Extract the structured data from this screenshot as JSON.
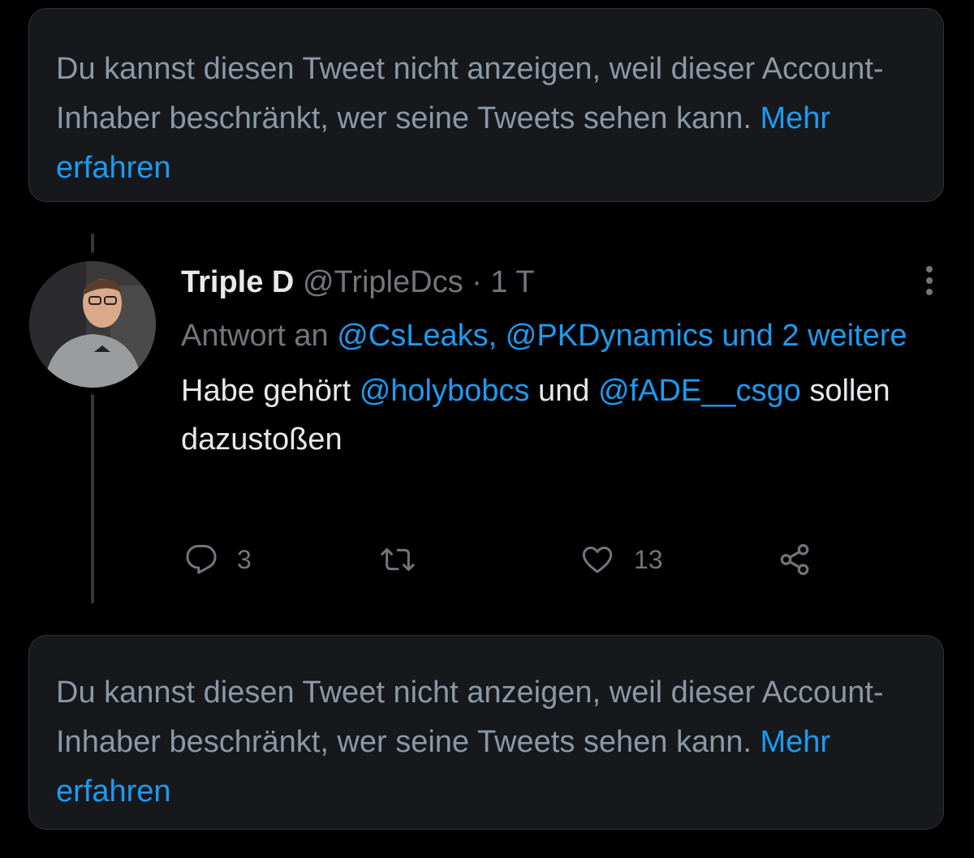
{
  "notice_top": {
    "text": "Du kannst diesen Tweet nicht anzeigen, weil dieser Account-Inhaber beschränkt, wer seine Tweets sehen kann.",
    "link": "Mehr erfahren"
  },
  "tweet": {
    "name": "Triple D",
    "handle": "@TripleDcs",
    "separator": "·",
    "time": "1 T",
    "reply_prefix": "Antwort an",
    "reply_mention_1": "@CsLeaks,",
    "reply_mention_2": "@PKDynamics",
    "reply_more": "und 2 weitere",
    "body_part_1": "Habe gehört",
    "body_mention_1": "@holybobcs",
    "body_part_2": "und",
    "body_mention_2": "@fADE__csgo",
    "body_part_3": "sollen dazustoßen",
    "reply_count": "3",
    "retweet_count": "",
    "like_count": "13"
  },
  "notice_bottom": {
    "text": "Du kannst diesen Tweet nicht anzeigen, weil dieser Account-Inhaber beschränkt, wer seine Tweets sehen kann.",
    "link": "Mehr erfahren"
  },
  "icons": {
    "more": "more-vertical-icon",
    "reply": "reply-icon",
    "retweet": "retweet-icon",
    "like": "heart-icon",
    "share": "share-icon"
  },
  "colors": {
    "background": "#000000",
    "card": "#16181c",
    "accent": "#1d9bf0",
    "muted": "#71767b",
    "text": "#e7e9ea"
  }
}
